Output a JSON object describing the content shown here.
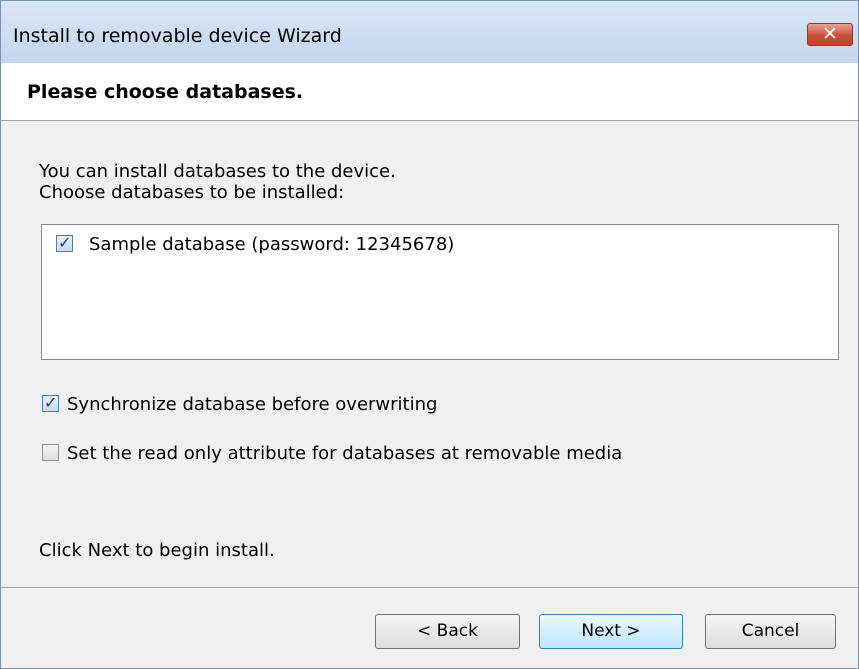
{
  "window": {
    "title": "Install to removable device Wizard",
    "close_glyph": "✕"
  },
  "header": {
    "title": "Please choose databases."
  },
  "intro": {
    "line1": "You can install databases to the device.",
    "line2": "Choose databases to be installed:"
  },
  "databases": [
    {
      "label": "Sample database (password: 12345678)",
      "checked": true
    }
  ],
  "options": {
    "synchronize": {
      "label": "Synchronize database before overwriting",
      "checked": true
    },
    "read_only": {
      "label": "Set the read only attribute for databases at removable media",
      "checked": false
    }
  },
  "footer_text": "Click Next to begin install.",
  "buttons": {
    "back": "< Back",
    "next": "Next >",
    "cancel": "Cancel"
  },
  "check_glyph": "✓"
}
